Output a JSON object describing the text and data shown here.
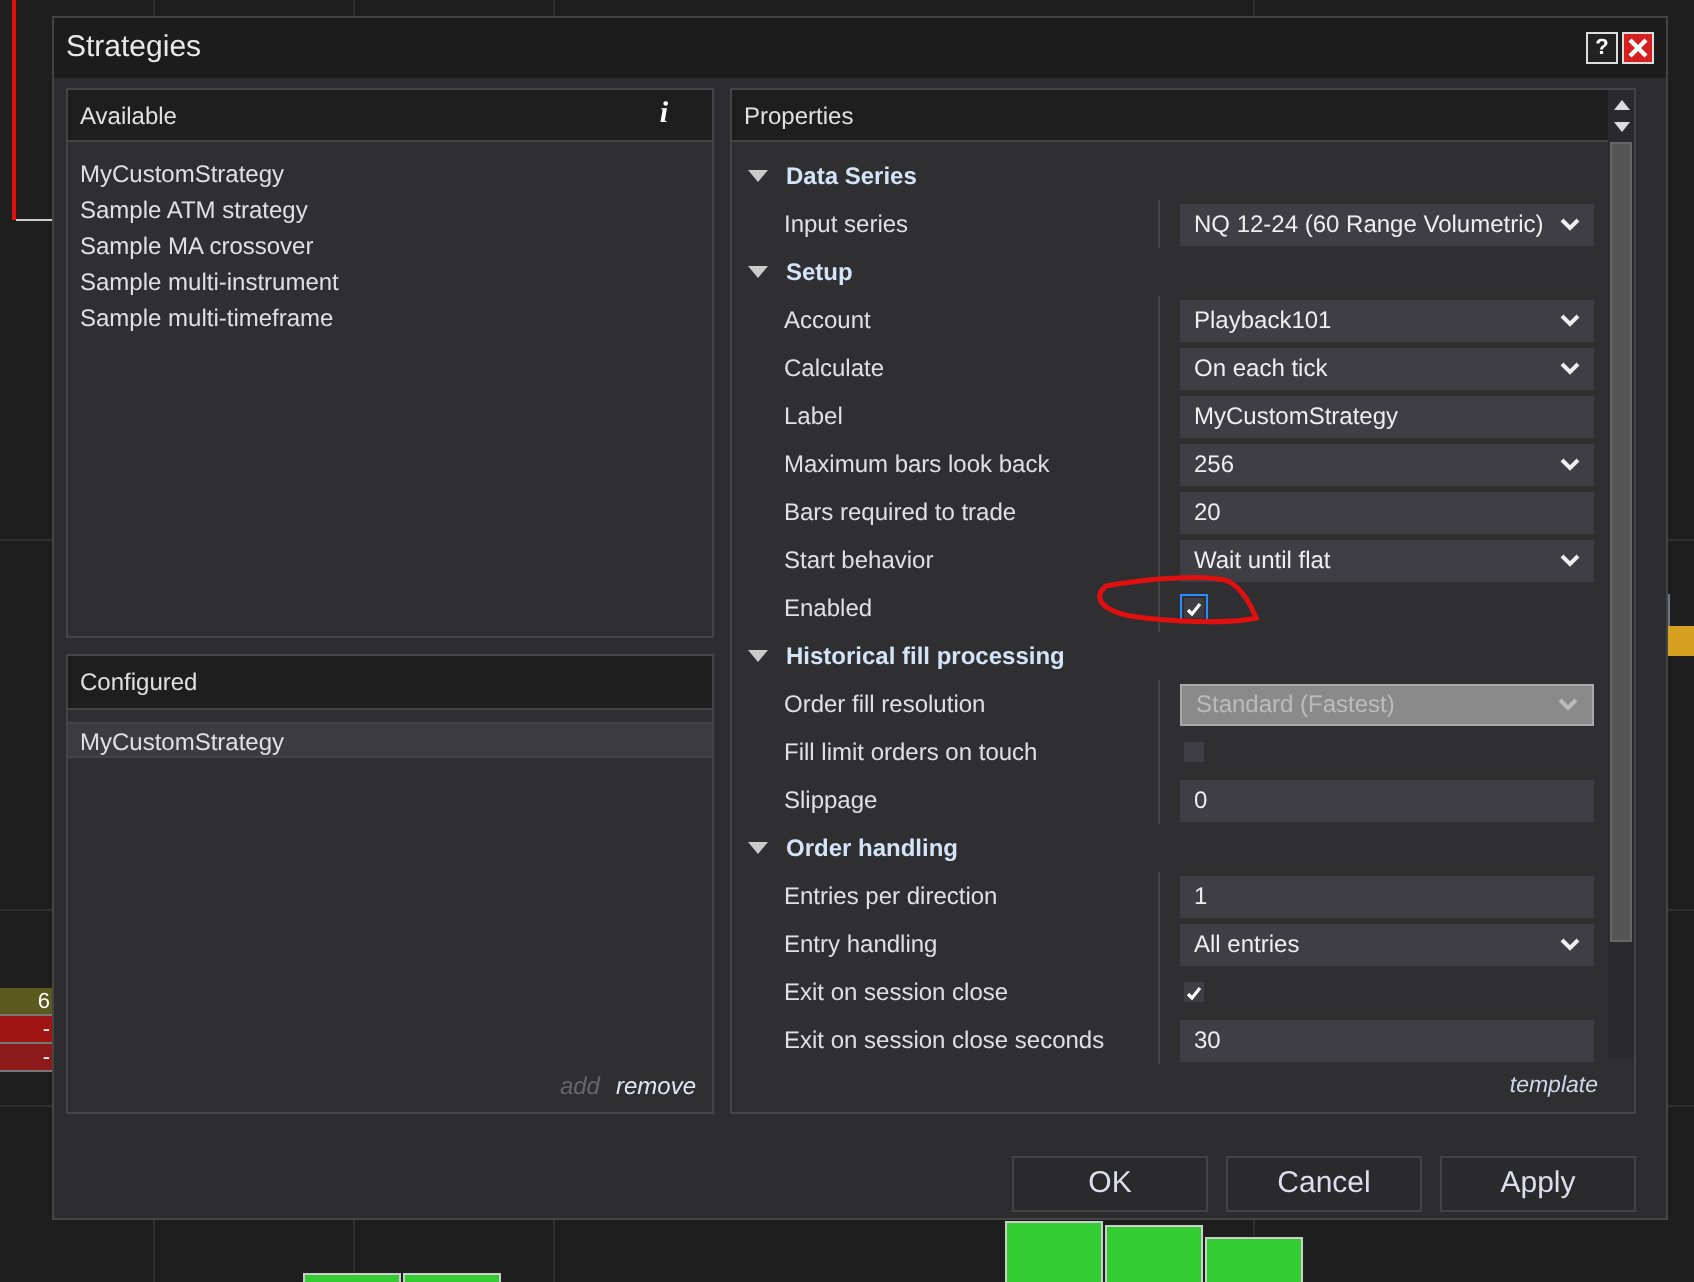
{
  "window": {
    "title": "Strategies",
    "help_label": "?"
  },
  "available": {
    "title": "Available",
    "info_label": "i",
    "items": [
      {
        "label": "MyCustomStrategy",
        "selected": false
      },
      {
        "label": "Sample ATM strategy",
        "selected": false
      },
      {
        "label": "Sample MA crossover",
        "selected": false
      },
      {
        "label": "Sample multi-instrument",
        "selected": false
      },
      {
        "label": "Sample multi-timeframe",
        "selected": false
      }
    ]
  },
  "configured": {
    "title": "Configured",
    "items": [
      {
        "label": "MyCustomStrategy",
        "selected": true
      }
    ],
    "actions": [
      {
        "label": "add",
        "disabled": true
      },
      {
        "label": "remove",
        "disabled": false
      }
    ]
  },
  "properties": {
    "title": "Properties",
    "sections": [
      {
        "name": "Data Series",
        "expanded": true,
        "rows": [
          {
            "label": "Input series",
            "kind": "dropdown",
            "value": "NQ 12-24 (60 Range Volumetric)",
            "disabled": false
          }
        ]
      },
      {
        "name": "Setup",
        "expanded": true,
        "rows": [
          {
            "label": "Account",
            "kind": "dropdown",
            "value": "Playback101",
            "disabled": false
          },
          {
            "label": "Calculate",
            "kind": "dropdown",
            "value": "On each tick",
            "disabled": false
          },
          {
            "label": "Label",
            "kind": "text",
            "value": "MyCustomStrategy"
          },
          {
            "label": "Maximum bars look back",
            "kind": "dropdown",
            "value": "256",
            "disabled": false
          },
          {
            "label": "Bars required to trade",
            "kind": "text",
            "value": "20"
          },
          {
            "label": "Start behavior",
            "kind": "dropdown",
            "value": "Wait until flat",
            "disabled": false
          },
          {
            "label": "Enabled",
            "kind": "checkbox",
            "checked": true,
            "focused": true
          }
        ]
      },
      {
        "name": "Historical fill processing",
        "expanded": true,
        "rows": [
          {
            "label": "Order fill resolution",
            "kind": "dropdown",
            "value": "Standard (Fastest)",
            "disabled": true
          },
          {
            "label": "Fill limit orders on touch",
            "kind": "checkbox",
            "checked": false,
            "focused": false
          },
          {
            "label": "Slippage",
            "kind": "text",
            "value": "0"
          }
        ]
      },
      {
        "name": "Order handling",
        "expanded": true,
        "rows": [
          {
            "label": "Entries per direction",
            "kind": "text",
            "value": "1"
          },
          {
            "label": "Entry handling",
            "kind": "dropdown",
            "value": "All entries",
            "disabled": false
          },
          {
            "label": "Exit on session close",
            "kind": "checkbox",
            "checked": true,
            "focused": false
          },
          {
            "label": "Exit on session close seconds",
            "kind": "text",
            "value": "30"
          }
        ]
      }
    ],
    "footer_link": "template"
  },
  "buttons": [
    "OK",
    "Cancel",
    "Apply"
  ],
  "background_cells": [
    {
      "text": "6",
      "color": "#5a5a1e"
    },
    {
      "text": "-",
      "color": "#a01414"
    },
    {
      "text": "-",
      "color": "#8c1a1a"
    }
  ]
}
